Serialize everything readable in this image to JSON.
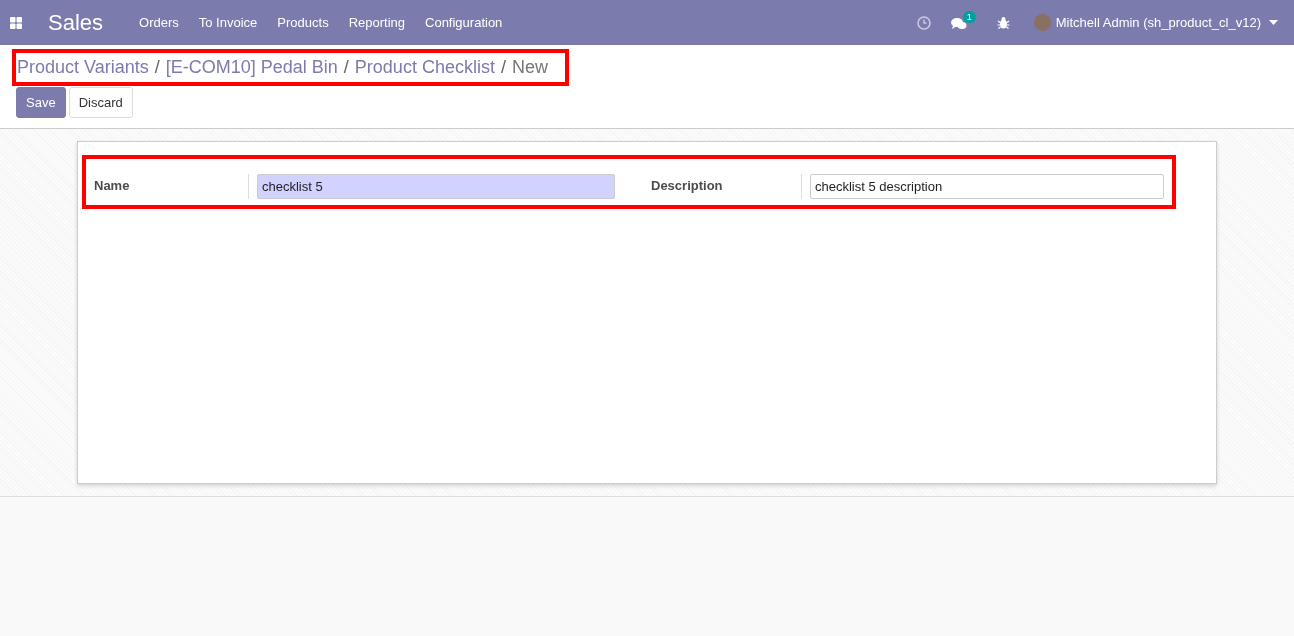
{
  "navbar": {
    "app_name": "Sales",
    "menu": [
      "Orders",
      "To Invoice",
      "Products",
      "Reporting",
      "Configuration"
    ],
    "message_count": "1",
    "user": "Mitchell Admin (sh_product_cl_v12)"
  },
  "breadcrumbs": [
    {
      "label": "Product Variants",
      "link": true
    },
    {
      "label": "[E-COM10] Pedal Bin",
      "link": true
    },
    {
      "label": "Product Checklist",
      "link": true
    },
    {
      "label": "New",
      "link": false
    }
  ],
  "separator": "/",
  "buttons": [
    {
      "label": "Save",
      "kind": "primary"
    },
    {
      "label": "Discard",
      "kind": "secondary"
    }
  ],
  "fields": [
    {
      "label": "Name",
      "value": "checklist 5",
      "required": true
    },
    {
      "label": "Description",
      "value": "checklist 5 description",
      "required": false
    }
  ]
}
